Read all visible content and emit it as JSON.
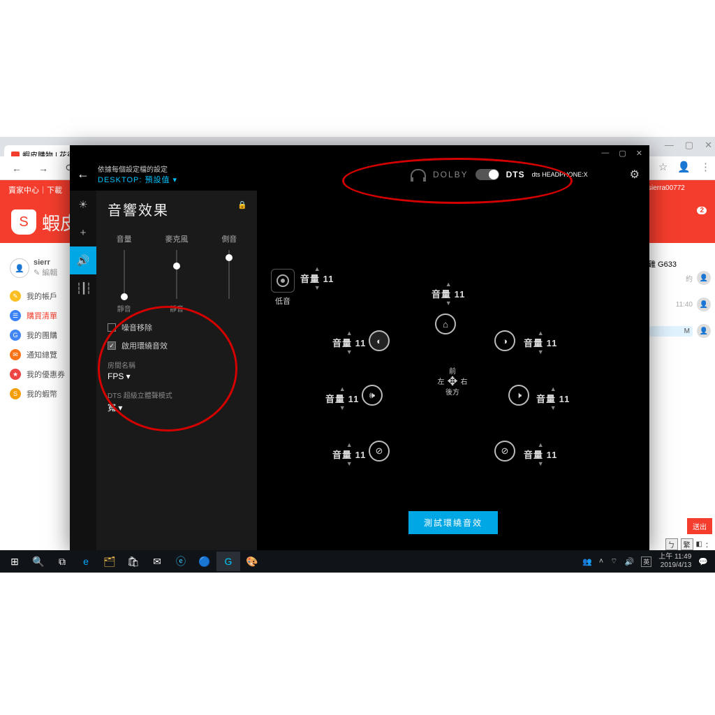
{
  "browser": {
    "tab_title": "蝦皮購物 | 花得",
    "nav_back": "←",
    "nav_fwd": "→",
    "nav_reload": "⟳"
  },
  "shopee": {
    "topbar_left": "賣家中心｜下載",
    "logo_text": "蝦皮",
    "user_partial": "sierr",
    "edit_label": "✎ 編輯",
    "right_user": "sierra00772",
    "badge": "2",
    "product_hint": "雞 G633",
    "send": "送出",
    "nav": [
      {
        "color": "#fbbf24",
        "glyph": "✎",
        "label": "我的帳戶"
      },
      {
        "color": "#3b82f6",
        "glyph": "☰",
        "label": "購買清單"
      },
      {
        "color": "#4285f4",
        "glyph": "G",
        "label": "我的團購"
      },
      {
        "color": "#f97316",
        "glyph": "✉",
        "label": "通知總覽"
      },
      {
        "color": "#ef4444",
        "glyph": "★",
        "label": "我的優惠券"
      },
      {
        "color": "#f59e0b",
        "glyph": "S",
        "label": "我的蝦幣"
      }
    ]
  },
  "ghub": {
    "win": {
      "min": "—",
      "max": "▢",
      "close": "✕"
    },
    "profile_label": "依據每個設定檔的設定",
    "profile_value": "DESKTOP: 預設值  ▾",
    "dolby": "DOLBY",
    "dts": "DTS",
    "dts_logo": "dts HEADPHONE:X",
    "gear": "⚙",
    "panel_title": "音響效果",
    "sliders": [
      {
        "label": "音量",
        "bottom": "靜音",
        "pos": 62
      },
      {
        "label": "麥克風",
        "bottom": "靜音",
        "pos": 18
      },
      {
        "label": "側音",
        "bottom": "",
        "pos": 6
      }
    ],
    "noise_removal": "噪音移除",
    "enable_surround": "啟用環繞音效",
    "room_label": "房間名稱",
    "room_value": "FPS  ▾",
    "dts_mode_label": "DTS 超級立體聲模式",
    "dts_mode_value": "寬  ▾",
    "bass": {
      "title": "低音",
      "vol": "音量 11"
    },
    "volume_word": "音量",
    "vol_val": "11",
    "front": "前",
    "left": "左",
    "right": "右",
    "rear": "後方",
    "test_btn": "測試環繞音效"
  },
  "taskbar": {
    "time": "上午 11:49",
    "date": "2019/4/13"
  },
  "right_chat": [
    {
      "time": "11:40"
    },
    {
      "time": "M"
    }
  ]
}
